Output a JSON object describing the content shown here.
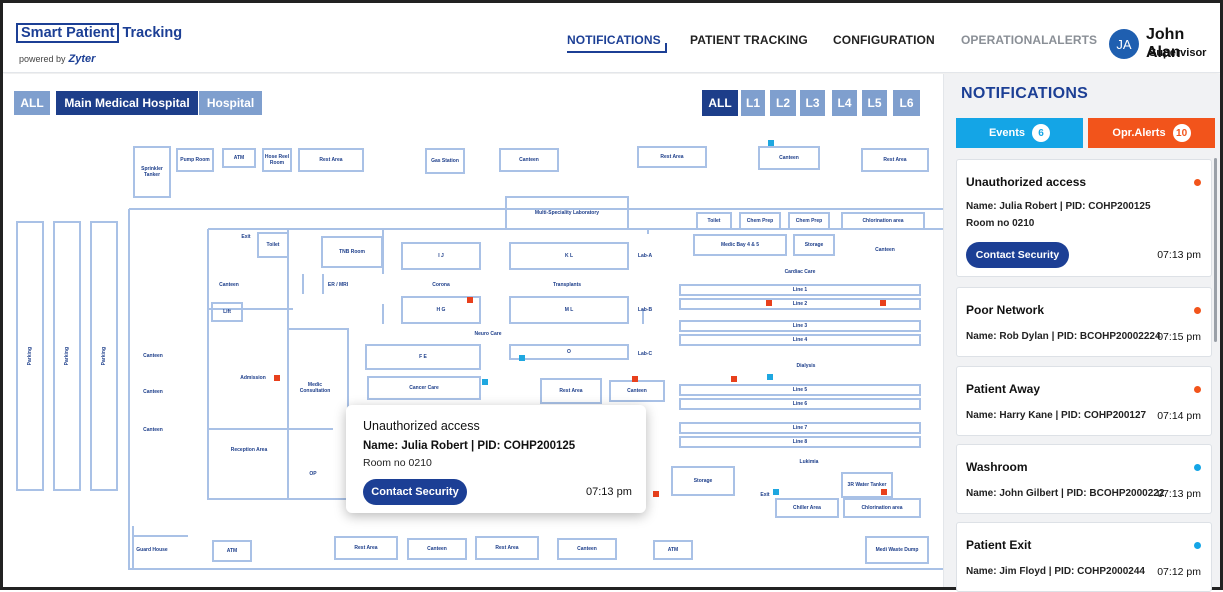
{
  "header": {
    "brand_box": "Smart Patient",
    "brand_rest": "Tracking",
    "powered_by": "powered by",
    "powered_brand": "Zyter",
    "nav": {
      "notifications": "NOTIFICATIONS",
      "patient_tracking": "PATIENT TRACKING",
      "configuration": "CONFIGURATION",
      "operational_alerts": "OPERATIONALALERTS"
    },
    "user": {
      "initials": "JA",
      "name": "John Alan",
      "role": "Supervisor"
    }
  },
  "filters": {
    "scope": [
      "ALL",
      "Main Medical Hospital",
      "Hospital"
    ],
    "levels": [
      "ALL",
      "L1",
      "L2",
      "L3",
      "L4",
      "L5",
      "L6"
    ],
    "selected_scope": "Main Medical Hospital",
    "selected_level": "ALL"
  },
  "map": {
    "parking": [
      "Parking",
      "Parking",
      "Parking"
    ],
    "rooms": {
      "sprinkler": "Sprinkler Tanker",
      "pump": "Pump Room",
      "atm_top": "ATM",
      "hose": "Hose Reel Room",
      "rest_top1": "Rest Area",
      "gas": "Gas Station",
      "canteen_top": "Canteen",
      "rest_top2": "Rest Area",
      "canteen_top2": "Canteen",
      "rest_top3": "Rest Area",
      "multi_lab": "Multi-Speciality Laboratory",
      "toilet_r": "Toilet",
      "chem1": "Chem Prep",
      "chem2": "Chem Prep",
      "chlor_top": "Chlorination area",
      "medic_bay": "Medic Bay 4 & 5",
      "storage_r": "Storage",
      "canteen_r": "Canteen",
      "exit_a": "Exit",
      "toilet": "Toilet",
      "tnb": "TNB Room",
      "ij": "I J",
      "kl": "K L",
      "laba": "Lab-A",
      "cardiac": "Cardiac Care",
      "canteen_l1": "Canteen",
      "er": "ER / MRI",
      "corona": "Corona",
      "transplants": "Transplants",
      "line1": "Line 1",
      "line2": "Line 2",
      "lift": "Lift",
      "hg": "H G",
      "ml": "M L",
      "labb": "Lab-B",
      "neuro": "Neuro Care",
      "line3": "Line 3",
      "line4": "Line 4",
      "canteen_l2": "Canteen",
      "fe": "F E",
      "o": "O",
      "labc": "Lab-C",
      "dialysis": "Dialysis",
      "admission": "Admission",
      "medic_consult": "Medic Consultation",
      "cancer": "Cancer Care",
      "rest_mid": "Rest Area",
      "canteen_mid": "Canteen",
      "canteen_l3": "Canteen",
      "line5": "Line 5",
      "line6": "Line 6",
      "canteen_l4": "Canteen",
      "line7": "Line 7",
      "line8": "Line 8",
      "reception": "Reception Area",
      "op": "OP",
      "lukimia": "Lukimia",
      "storage_mid": "Storage",
      "water": "3R Water Tanker",
      "chiller": "Chiller Area",
      "chlor_bot": "Chlorination area",
      "exit_b": "Exit",
      "guard": "Guard House",
      "atm_bot1": "ATM",
      "rest_bot1": "Rest Area",
      "canteen_bot1": "Canteen",
      "rest_bot2": "Rest Area",
      "canteen_bot2": "Canteen",
      "atm_bot2": "ATM",
      "medi_waste": "Medi Waste Dump"
    }
  },
  "popup": {
    "title": "Unauthorized access",
    "name_line": "Name: Julia Robert  | PID: COHP200125",
    "room": "Room no 0210",
    "button": "Contact Security",
    "time": "07:13 pm"
  },
  "panel": {
    "title": "NOTIFICATIONS",
    "events_label": "Events",
    "events_count": "6",
    "opr_label": "Opr.Alerts",
    "opr_count": "10",
    "colors": {
      "events": "#14a5e6",
      "opr": "#f2541b",
      "red_dot": "#f2541b",
      "blue_dot": "#14a5e6"
    },
    "cards": [
      {
        "title": "Unauthorized access",
        "name": "Name: Julia Robert  | PID: COHP200125",
        "room": "Room no 0210",
        "button": "Contact Security",
        "time": "07:13 pm",
        "dot": "red"
      },
      {
        "title": "Poor Network",
        "name": "Name: Rob Dylan | PID: BCOHP20002224",
        "time": "07:15 pm",
        "dot": "red"
      },
      {
        "title": "Patient Away",
        "name": "Name: Harry Kane | PID: COHP200127",
        "time": "07:14 pm",
        "dot": "red"
      },
      {
        "title": "Washroom",
        "name": "Name: John Gilbert | PID: BCOHP2000222",
        "time": "07:13 pm",
        "dot": "blue"
      },
      {
        "title": "Patient Exit",
        "name": "Name: Jim Floyd | PID: COHP2000244",
        "time": "07:12 pm",
        "dot": "blue"
      }
    ]
  }
}
